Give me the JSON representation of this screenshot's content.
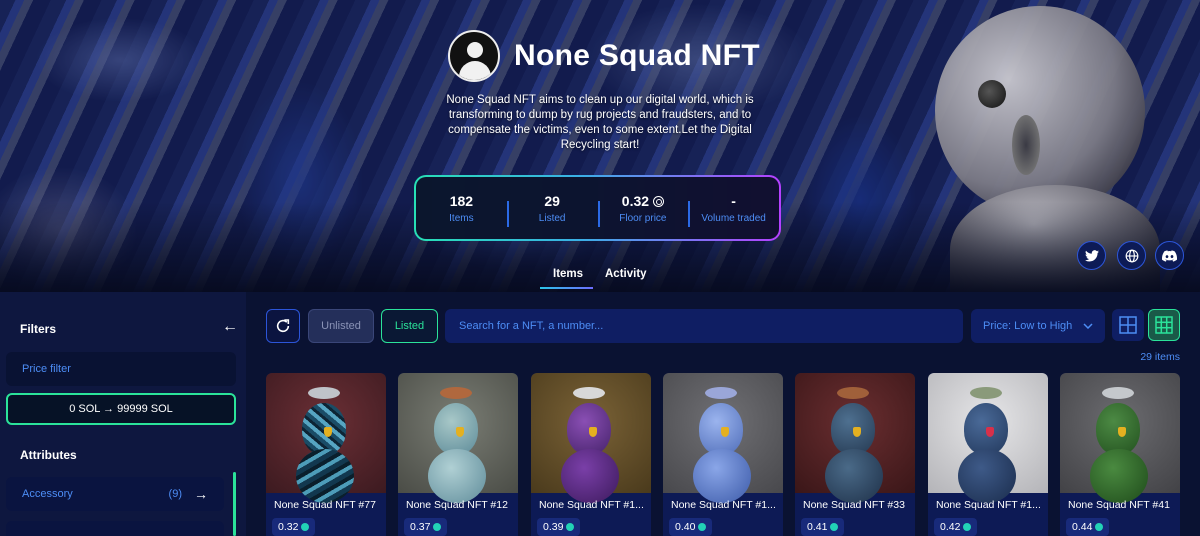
{
  "collection": {
    "name": "None Squad NFT",
    "description": "None Squad NFT aims to clean up our digital world, which is transforming to dump by rug projects and fraudsters, and to compensate the victims, even to some extent.Let the Digital Recycling start!"
  },
  "stats": [
    {
      "value": "182",
      "label": "Items"
    },
    {
      "value": "29",
      "label": "Listed"
    },
    {
      "value": "0.32",
      "label": "Floor price"
    },
    {
      "value": "-",
      "label": "Volume traded"
    }
  ],
  "social": {
    "twitter_icon": "twitter-icon",
    "website_icon": "globe-icon",
    "discord_icon": "discord-icon"
  },
  "tabs": {
    "items": "Items",
    "activity": "Activity"
  },
  "sidebar": {
    "filters_title": "Filters",
    "price_filter_label": "Price filter",
    "price_range": "0 SOL → 99999 SOL",
    "attributes_title": "Attributes",
    "attributes": [
      {
        "label": "Accessory",
        "count": "(9)"
      }
    ]
  },
  "toolbar": {
    "unlisted": "Unlisted",
    "listed": "Listed",
    "search_placeholder": "Search for a NFT, a number...",
    "sort": "Price: Low to High",
    "count": "29 items"
  },
  "colors": {
    "accent_green": "#2be39a",
    "accent_blue": "#4d8df5",
    "background": "#0a1232"
  },
  "cards": [
    {
      "name": "None Squad NFT #77",
      "price": "0.32"
    },
    {
      "name": "None Squad NFT #12",
      "price": "0.37"
    },
    {
      "name": "None Squad NFT #1...",
      "price": "0.39"
    },
    {
      "name": "None Squad NFT #1...",
      "price": "0.40"
    },
    {
      "name": "None Squad NFT #33",
      "price": "0.41"
    },
    {
      "name": "None Squad NFT #1...",
      "price": "0.42"
    },
    {
      "name": "None Squad NFT #41",
      "price": "0.44"
    }
  ]
}
